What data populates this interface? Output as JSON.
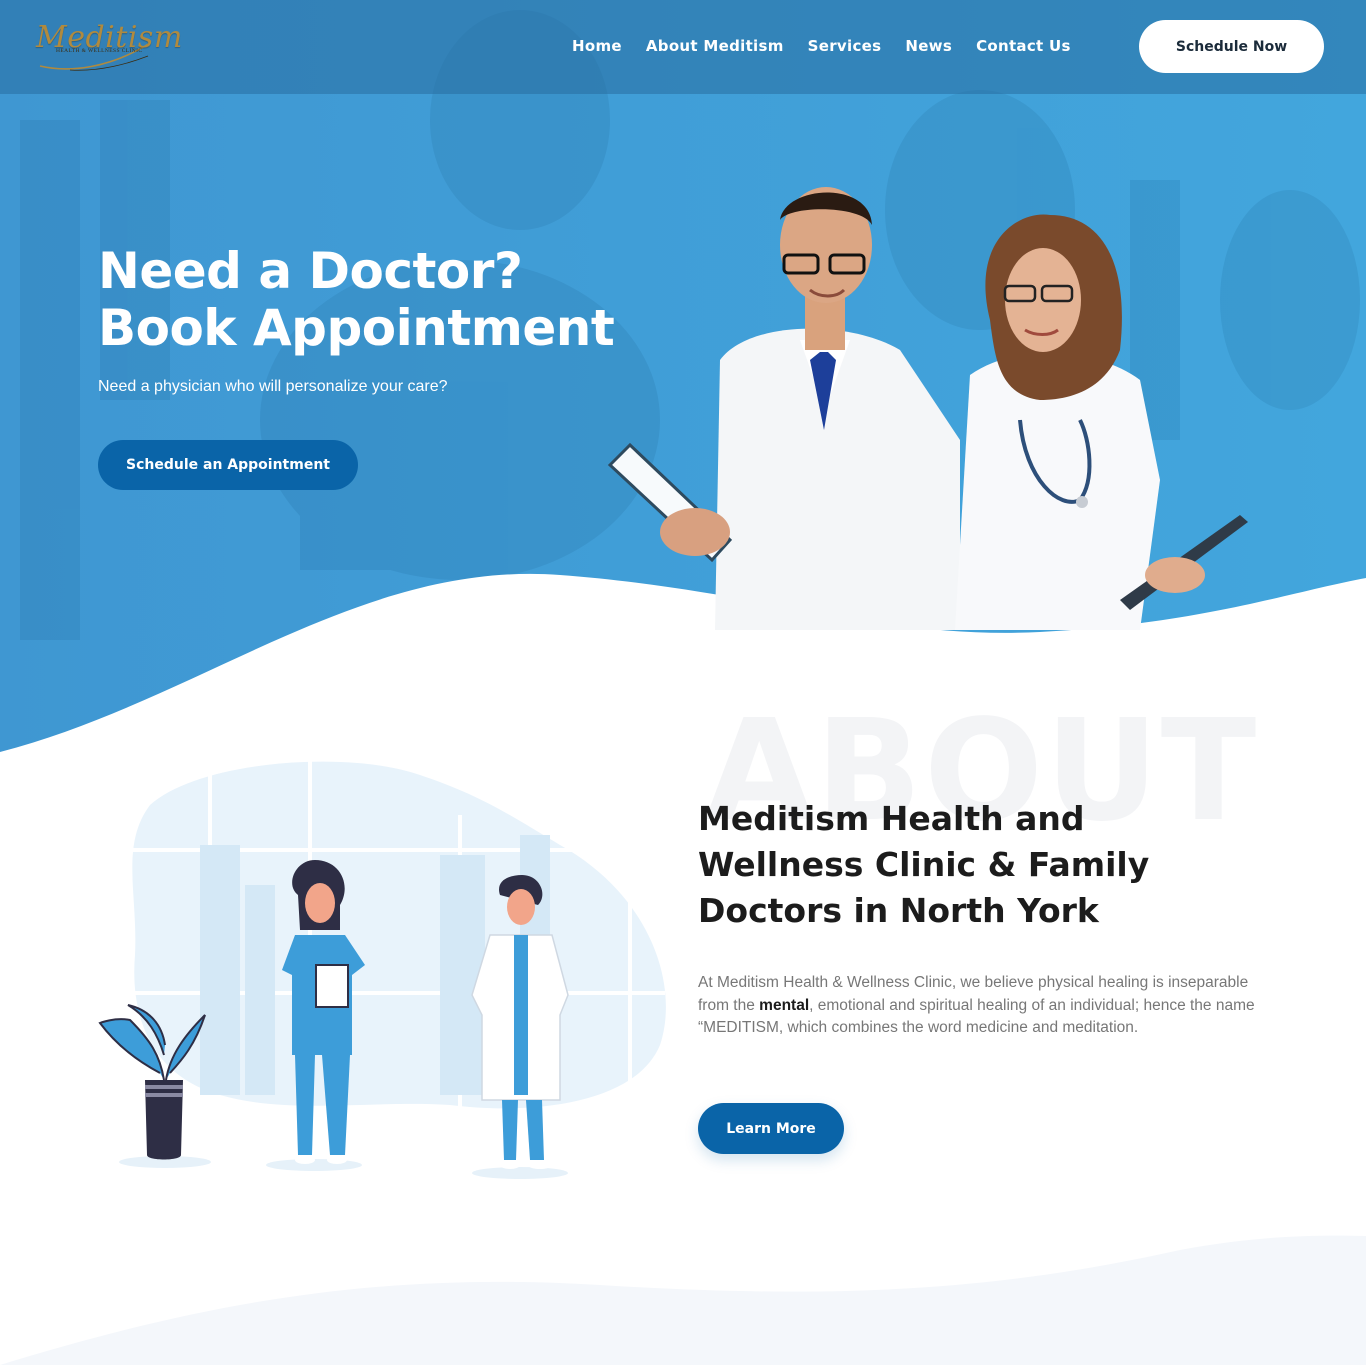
{
  "header": {
    "logo_text": "Meditism",
    "logo_subtext": "HEALTH & WELLNESS CLINIC",
    "nav": [
      {
        "label": "Home"
      },
      {
        "label": "About Meditism"
      },
      {
        "label": "Services"
      },
      {
        "label": "News"
      },
      {
        "label": "Contact Us"
      }
    ],
    "schedule_button": "Schedule Now"
  },
  "hero": {
    "title_line1": "Need a Doctor?",
    "title_line2": "Book Appointment",
    "subtitle": "Need a physician who will personalize your care?",
    "cta": "Schedule an Appointment"
  },
  "about": {
    "background_word": "ABOUT",
    "title": "Meditism Health and Wellness Clinic & Family Doctors in North York",
    "text_before": "At Meditism Health & Wellness Clinic, we believe physical healing is inseparable from the ",
    "text_bold": "mental",
    "text_after": ", emotional and spiritual healing of an individual; hence the name “MEDITISM, which combines the word medicine and meditation.",
    "cta": "Learn More"
  },
  "colors": {
    "hero_blue": "#3a9ad6",
    "button_blue": "#0a64a8",
    "logo_gold": "#b08a3e",
    "heading_dark": "#1c1c1c",
    "body_gray": "#777777"
  },
  "icons": {
    "doctors_photo": "two-doctors-photo",
    "illustration": "medical-staff-illustration"
  }
}
